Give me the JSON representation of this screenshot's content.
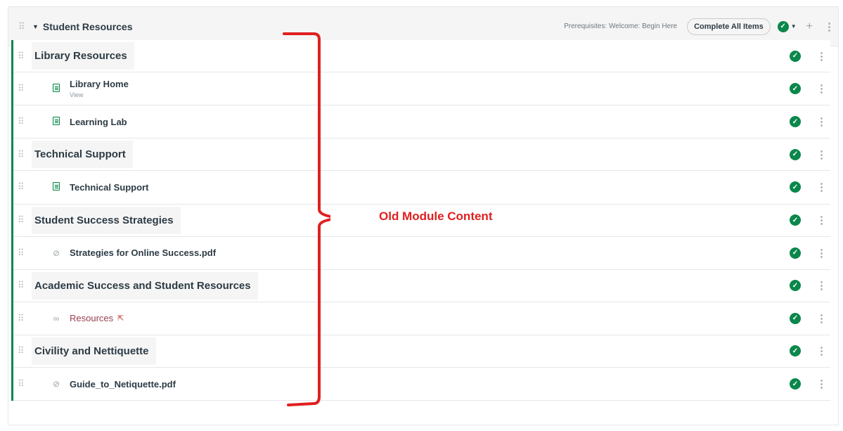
{
  "module": {
    "title": "Student Resources",
    "prerequisites": "Prerequisites: Welcome: Begin Here",
    "complete_label": "Complete All Items"
  },
  "rows": [
    {
      "kind": "header",
      "label": "Library Resources"
    },
    {
      "kind": "item",
      "icon": "page-icon",
      "label": "Library Home",
      "sub": "View"
    },
    {
      "kind": "item",
      "icon": "page-icon",
      "label": "Learning Lab"
    },
    {
      "kind": "header",
      "label": "Technical Support"
    },
    {
      "kind": "item",
      "icon": "page-icon",
      "label": "Technical Support"
    },
    {
      "kind": "header",
      "label": "Student Success Strategies"
    },
    {
      "kind": "item",
      "icon": "paperclip-icon",
      "label": "Strategies for Online Success.pdf"
    },
    {
      "kind": "header",
      "label": "Academic Success and Student Resources"
    },
    {
      "kind": "item",
      "icon": "link-icon",
      "label": "Resources",
      "external": true
    },
    {
      "kind": "header",
      "label": "Civility and Nettiquette"
    },
    {
      "kind": "item",
      "icon": "paperclip-icon",
      "label": "Guide_to_Netiquette.pdf"
    }
  ],
  "annotation": {
    "text": "Old Module Content",
    "color": "#e02020"
  },
  "colors": {
    "complete_green": "#0b874b",
    "link_color": "#9c3f4e"
  }
}
